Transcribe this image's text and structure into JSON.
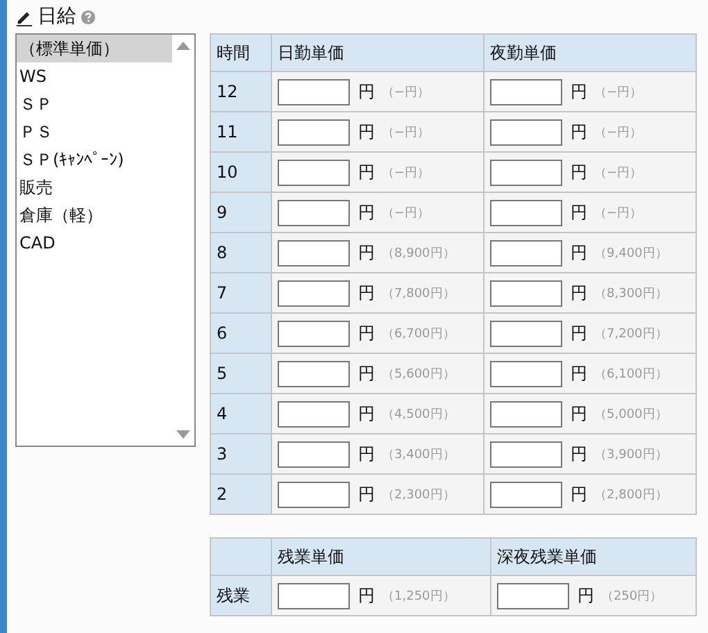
{
  "section": {
    "title": "日給"
  },
  "listbox": {
    "items": [
      {
        "label": "（標準単価）",
        "selected": true
      },
      {
        "label": "WS",
        "selected": false
      },
      {
        "label": "ＳＰ",
        "selected": false
      },
      {
        "label": "ＰＳ",
        "selected": false
      },
      {
        "label": "ＳＰ(ｷｬﾝﾍﾟｰﾝ)",
        "selected": false
      },
      {
        "label": "販売",
        "selected": false
      },
      {
        "label": "倉庫（軽）",
        "selected": false
      },
      {
        "label": "CAD",
        "selected": false
      }
    ]
  },
  "rate_table": {
    "columns": [
      "時間",
      "日勤単価",
      "夜勤単価"
    ],
    "rows": [
      {
        "hours": "12",
        "day_unit": "円",
        "day_hint": "（−円）",
        "night_unit": "円",
        "night_hint": "（−円）"
      },
      {
        "hours": "11",
        "day_unit": "円",
        "day_hint": "（−円）",
        "night_unit": "円",
        "night_hint": "（−円）"
      },
      {
        "hours": "10",
        "day_unit": "円",
        "day_hint": "（−円）",
        "night_unit": "円",
        "night_hint": "（−円）"
      },
      {
        "hours": "9",
        "day_unit": "円",
        "day_hint": "（−円）",
        "night_unit": "円",
        "night_hint": "（−円）"
      },
      {
        "hours": "8",
        "day_unit": "円",
        "day_hint": "（8,900円）",
        "night_unit": "円",
        "night_hint": "（9,400円）"
      },
      {
        "hours": "7",
        "day_unit": "円",
        "day_hint": "（7,800円）",
        "night_unit": "円",
        "night_hint": "（8,300円）"
      },
      {
        "hours": "6",
        "day_unit": "円",
        "day_hint": "（6,700円）",
        "night_unit": "円",
        "night_hint": "（7,200円）"
      },
      {
        "hours": "5",
        "day_unit": "円",
        "day_hint": "（5,600円）",
        "night_unit": "円",
        "night_hint": "（6,100円）"
      },
      {
        "hours": "4",
        "day_unit": "円",
        "day_hint": "（4,500円）",
        "night_unit": "円",
        "night_hint": "（5,000円）"
      },
      {
        "hours": "3",
        "day_unit": "円",
        "day_hint": "（3,400円）",
        "night_unit": "円",
        "night_hint": "（3,900円）"
      },
      {
        "hours": "2",
        "day_unit": "円",
        "day_hint": "（2,300円）",
        "night_unit": "円",
        "night_hint": "（2,800円）"
      }
    ]
  },
  "overtime_table": {
    "columns": [
      "残業単価",
      "深夜残業単価"
    ],
    "rows": [
      {
        "label": "残業",
        "ot_unit": "円",
        "ot_hint": "（1,250円）",
        "late_unit": "円",
        "late_hint": "（250円）"
      }
    ]
  }
}
